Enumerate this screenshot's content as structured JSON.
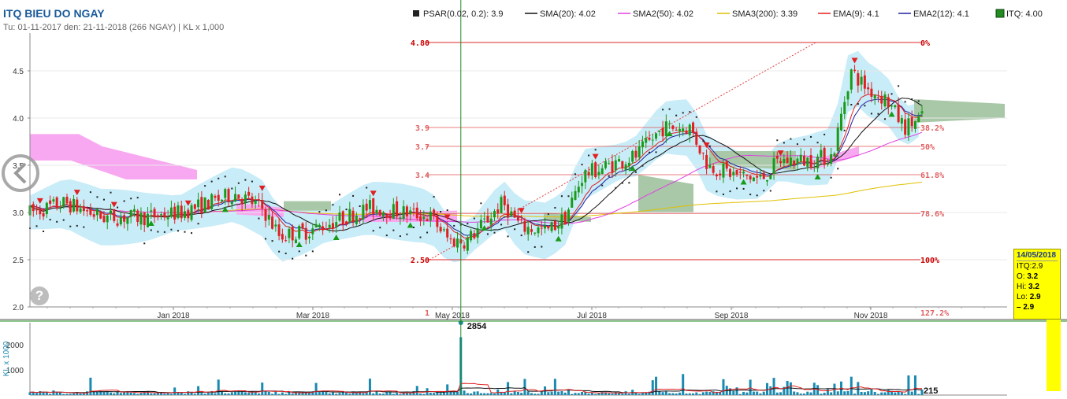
{
  "header": {
    "title": "ITQ BIEU DO NGAY",
    "subtitle": "Tu: 01-11-2017 den: 21-11-2018 (266 NGAY) | KL x 1,000"
  },
  "legend": [
    {
      "label": "PSAR(0.02, 0.2): 3.9",
      "color": "#222222",
      "kind": "square"
    },
    {
      "label": "SMA(20): 4.02",
      "color": "#111111",
      "kind": "line"
    },
    {
      "label": "SMA2(50): 4.02",
      "color": "#e040e0",
      "kind": "line"
    },
    {
      "label": "SMA3(200): 3.39",
      "color": "#e0c000",
      "kind": "line"
    },
    {
      "label": "EMA(9): 4.1",
      "color": "#e02020",
      "kind": "line"
    },
    {
      "label": "EMA2(12): 4.1",
      "color": "#2020a0",
      "kind": "line"
    },
    {
      "label": "ITQ: 4.00",
      "color": "#228b22",
      "kind": "box"
    }
  ],
  "colors": {
    "up": "#1a9a1a",
    "down": "#e02020",
    "cloud_blue": "#c8ecf8",
    "cloud_pink": "#f8a8f0",
    "cloud_green": "#a8c8a8",
    "volume": "#1a8ab0",
    "crosshair": "#228b22",
    "fib_line": "#e04040",
    "highlight": "#ffff00"
  },
  "chart_data": {
    "type": "candlestick",
    "symbol": "ITQ",
    "x_tick_labels": [
      "Jan 2018",
      "Mar 2018",
      "May 2018",
      "Jul 2018",
      "Sep 2018",
      "Nov 2018"
    ],
    "y_ticks": [
      2.0,
      2.5,
      3.0,
      3.5,
      4.0,
      4.5
    ],
    "ylim": [
      2.0,
      4.85
    ],
    "fibonacci": [
      {
        "price": 4.8,
        "price_label": "4.80",
        "pct_label": "0%"
      },
      {
        "price": 3.9,
        "price_label": "3.9",
        "pct_label": "38.2%"
      },
      {
        "price": 3.7,
        "price_label": "3.7",
        "pct_label": "50%"
      },
      {
        "price": 3.4,
        "price_label": "3.4",
        "pct_label": "61.8%"
      },
      {
        "price": 2.99,
        "price_label": "",
        "pct_label": "78.6%"
      },
      {
        "price": 2.5,
        "price_label": "2.50",
        "pct_label": "100%"
      },
      {
        "price": 1.94,
        "price_label": "1",
        "pct_label": "127.2%"
      }
    ],
    "price_path": [
      {
        "t": 0.0,
        "p": 3.0
      },
      {
        "t": 0.04,
        "p": 3.1
      },
      {
        "t": 0.08,
        "p": 2.95
      },
      {
        "t": 0.13,
        "p": 2.95
      },
      {
        "t": 0.17,
        "p": 3.0
      },
      {
        "t": 0.2,
        "p": 3.1
      },
      {
        "t": 0.23,
        "p": 3.2
      },
      {
        "t": 0.26,
        "p": 3.05
      },
      {
        "t": 0.28,
        "p": 2.75
      },
      {
        "t": 0.31,
        "p": 2.8
      },
      {
        "t": 0.34,
        "p": 2.9
      },
      {
        "t": 0.38,
        "p": 3.05
      },
      {
        "t": 0.42,
        "p": 3.0
      },
      {
        "t": 0.45,
        "p": 2.95
      },
      {
        "t": 0.47,
        "p": 2.7
      },
      {
        "t": 0.49,
        "p": 2.7
      },
      {
        "t": 0.51,
        "p": 2.9
      },
      {
        "t": 0.53,
        "p": 3.1
      },
      {
        "t": 0.55,
        "p": 2.85
      },
      {
        "t": 0.58,
        "p": 2.8
      },
      {
        "t": 0.6,
        "p": 2.95
      },
      {
        "t": 0.62,
        "p": 3.4
      },
      {
        "t": 0.65,
        "p": 3.5
      },
      {
        "t": 0.68,
        "p": 3.6
      },
      {
        "t": 0.71,
        "p": 3.9
      },
      {
        "t": 0.74,
        "p": 3.9
      },
      {
        "t": 0.76,
        "p": 3.5
      },
      {
        "t": 0.79,
        "p": 3.4
      },
      {
        "t": 0.82,
        "p": 3.35
      },
      {
        "t": 0.84,
        "p": 3.55
      },
      {
        "t": 0.87,
        "p": 3.55
      },
      {
        "t": 0.9,
        "p": 3.6
      },
      {
        "t": 0.92,
        "p": 4.5
      },
      {
        "t": 0.94,
        "p": 4.3
      },
      {
        "t": 0.96,
        "p": 4.2
      },
      {
        "t": 0.98,
        "p": 3.9
      },
      {
        "t": 1.0,
        "p": 4.0
      }
    ],
    "volume": {
      "ylabel": "KL x 1000",
      "ticks": [
        0,
        1000,
        2000
      ],
      "tick_labels": [
        "",
        "1000",
        "2000"
      ],
      "peak_label": "2854",
      "peak_value": 2854,
      "last_label": "215",
      "last_value": 215
    }
  },
  "tooltip": {
    "date": "14/05/2018",
    "symbol_line": "ITQ:2.9",
    "open_label": "O:",
    "open_value": "3.2",
    "high_label": "Hi:",
    "high_value": "3.2",
    "low_label": "Lo:",
    "low_value": "2.9",
    "close_marker": "–",
    "close_value": "2.9"
  },
  "help_label": "?"
}
